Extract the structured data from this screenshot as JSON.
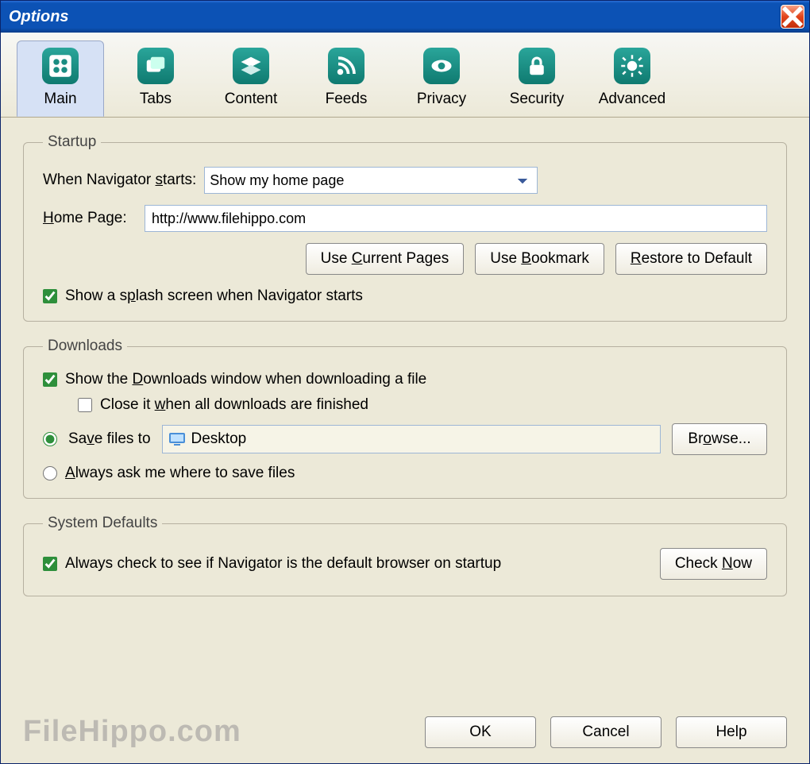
{
  "window": {
    "title": "Options"
  },
  "tabs": [
    {
      "label": "Main",
      "key": "main"
    },
    {
      "label": "Tabs",
      "key": "tabs"
    },
    {
      "label": "Content",
      "key": "content"
    },
    {
      "label": "Feeds",
      "key": "feeds"
    },
    {
      "label": "Privacy",
      "key": "privacy"
    },
    {
      "label": "Security",
      "key": "security"
    },
    {
      "label": "Advanced",
      "key": "advanced"
    }
  ],
  "startup": {
    "legend": "Startup",
    "when_label": "When Navigator starts:",
    "when_value": "Show my home page",
    "home_label": "Home Page:",
    "home_value": "http://www.filehippo.com",
    "use_current": "Use Current Pages",
    "use_bookmark": "Use Bookmark",
    "restore": "Restore to Default",
    "splash_label": "Show a splash screen when Navigator starts",
    "splash_checked": true
  },
  "downloads": {
    "legend": "Downloads",
    "show_window_label": "Show the Downloads window when downloading a file",
    "show_window_checked": true,
    "close_label": "Close it when all downloads are finished",
    "close_checked": false,
    "save_to_label": "Save files to",
    "save_to_selected": true,
    "save_location": "Desktop",
    "browse": "Browse...",
    "always_ask_label": "Always ask me where to save files",
    "always_ask_selected": false
  },
  "system": {
    "legend": "System Defaults",
    "check_label": "Always check to see if Navigator is the default browser on startup",
    "check_checked": true,
    "check_now": "Check Now"
  },
  "footer": {
    "watermark": "FileHippo.com",
    "ok": "OK",
    "cancel": "Cancel",
    "help": "Help"
  }
}
